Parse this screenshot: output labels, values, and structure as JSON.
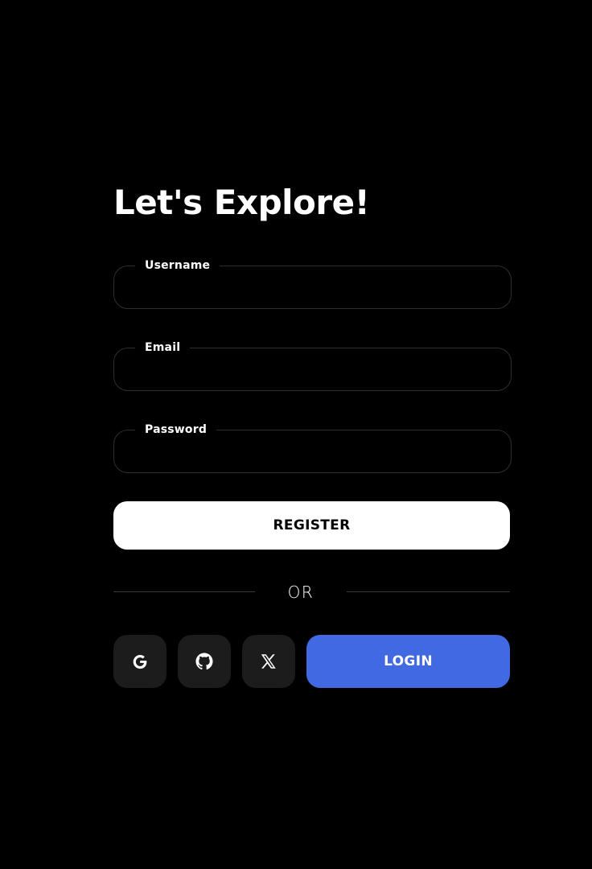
{
  "form": {
    "title": "Let's Explore!",
    "fields": [
      {
        "label": "Username",
        "value": "",
        "type": "text"
      },
      {
        "label": "Email",
        "value": "",
        "type": "email"
      },
      {
        "label": "Password",
        "value": "",
        "type": "password"
      }
    ],
    "register_label": "REGISTER",
    "divider_text": "OR",
    "social": [
      {
        "name": "google",
        "icon": "google-icon"
      },
      {
        "name": "github",
        "icon": "github-icon"
      },
      {
        "name": "x",
        "icon": "x-icon"
      }
    ],
    "login_label": "LOGIN"
  },
  "colors": {
    "background": "#000000",
    "register_bg": "#ffffff",
    "login_bg": "#4169e1",
    "social_bg": "#1c1c1c",
    "field_border": "#2e2e2e"
  }
}
